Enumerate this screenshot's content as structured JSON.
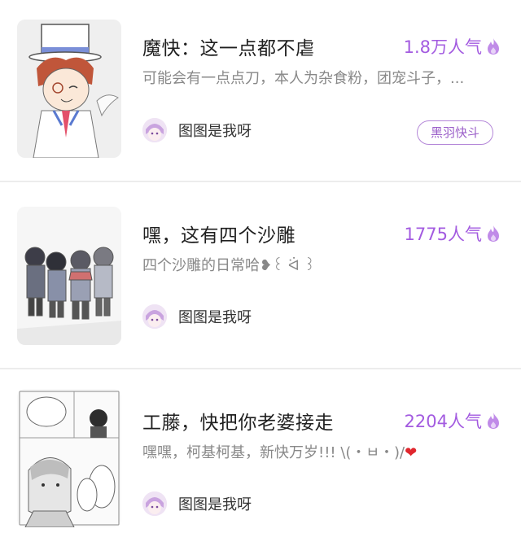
{
  "posts": [
    {
      "title": "魔快：这一点都不虐",
      "popularity": "1.8万人气",
      "description": "可能会有一点点刀，本人为杂食粉，团宠斗子，...",
      "author": "图图是我呀",
      "tag": "黑羽快斗"
    },
    {
      "title": "嘿，这有四个沙雕",
      "popularity": "1775人气",
      "description": "四个沙雕的日常哈❥꒰ ᐛ ꒱",
      "author": "图图是我呀"
    },
    {
      "title": "工藤，快把你老婆接走",
      "popularity": "2204人气",
      "description": "嘿嘿，柯基柯基，新快万岁!!! \\(・ㅂ・)/",
      "description_heart": "❤",
      "author": "图图是我呀"
    }
  ],
  "colors": {
    "accent": "#a35be0",
    "tag_border": "#b487d8",
    "separator": "#ececec",
    "heart": "#e0262d"
  },
  "icons": {
    "popularity": "flame-icon"
  }
}
